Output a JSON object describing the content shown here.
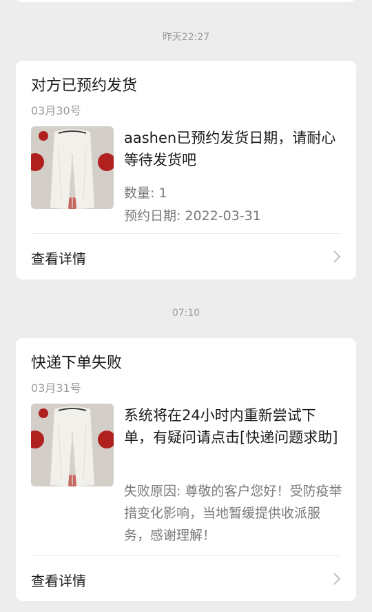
{
  "cards": [
    {
      "timestamp": "昨天22:27",
      "title": "对方已预约发货",
      "date": "03月30号",
      "thumbnail_icon": "product-photo-white-pants",
      "message": "aashen已预约发货日期，请耐心等待发货吧",
      "meta": [
        "数量: 1",
        "预约日期: 2022-03-31"
      ],
      "detail_label": "查看详情",
      "chevron_icon": "chevron-right-icon"
    },
    {
      "timestamp": "07:10",
      "title": "快递下单失败",
      "date": "03月31号",
      "thumbnail_icon": "product-photo-white-pants",
      "message": "系统将在24小时内重新尝试下单，有疑问请点击[快递问题求助]",
      "meta_block": "失败原因: 尊敬的客户您好！受防疫举措变化影响，当地暂缓提供收派服务，感谢理解！",
      "detail_label": "查看详情",
      "chevron_icon": "chevron-right-icon"
    }
  ],
  "colors": {
    "background": "#ededed",
    "card": "#ffffff",
    "primary_text": "#1a1a1a",
    "secondary_text": "#9b9b9b",
    "meta_text": "#7a7a7a"
  }
}
